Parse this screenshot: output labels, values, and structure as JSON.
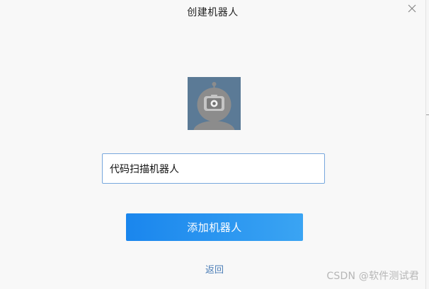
{
  "dialog": {
    "title": "创建机器人",
    "close_icon": "close-icon",
    "avatar_icon": "robot-camera-avatar-icon",
    "name_input": {
      "value": "代码扫描机器人",
      "placeholder": ""
    },
    "add_button_label": "添加机器人",
    "back_label": "返回"
  },
  "watermark": "CSDN @软件测试君",
  "colors": {
    "primary": "#1a86ed",
    "link": "#4c7eb7",
    "avatar_bg": "#5b7a96"
  }
}
